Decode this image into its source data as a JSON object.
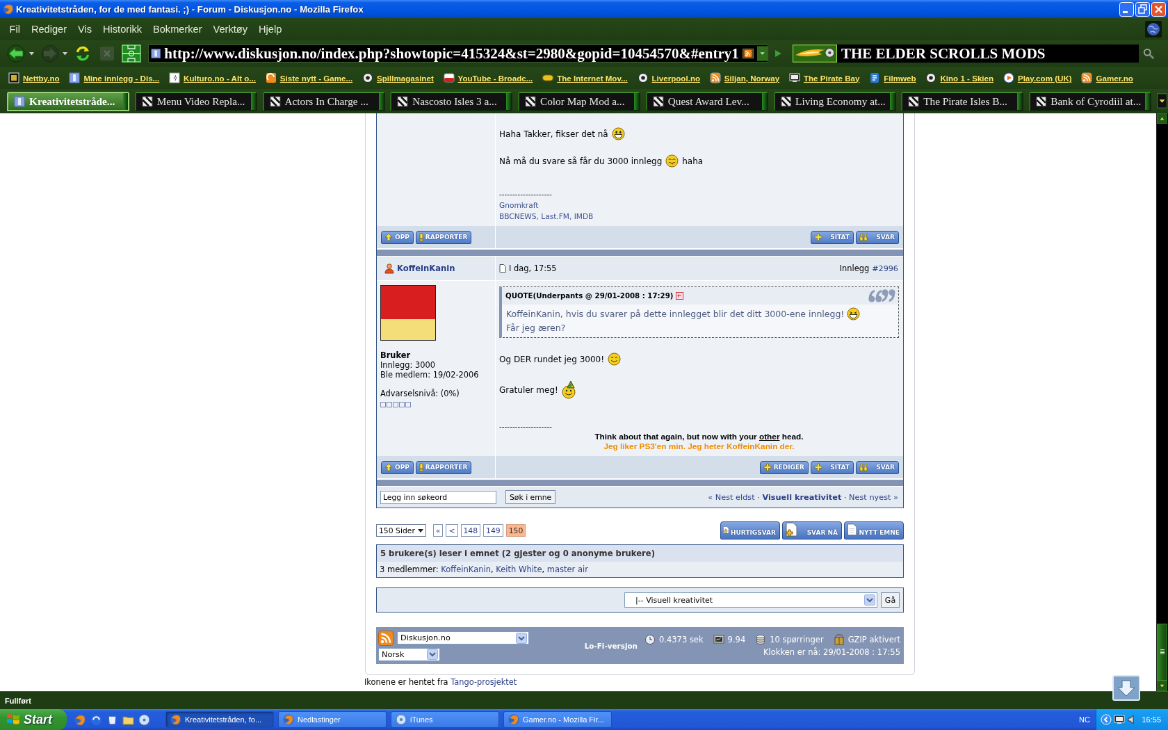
{
  "window": {
    "title": "Kreativitetstråden, for de med fantasi. ;) - Forum - Diskusjon.no - Mozilla Firefox"
  },
  "menu": [
    "Fil",
    "Rediger",
    "Vis",
    "Historikk",
    "Bokmerker",
    "Verktøy",
    "Hjelp"
  ],
  "toolbar": [
    {
      "kind": "back",
      "disabled": false
    },
    {
      "kind": "forward",
      "disabled": true
    },
    {
      "kind": "reload",
      "disabled": false
    },
    {
      "kind": "stop",
      "disabled": true
    },
    {
      "kind": "home",
      "disabled": false
    }
  ],
  "address_bar": {
    "value": "http://www.diskusjon.no/index.php?showtopic=415324&st=2980&gopid=10454570&#entry1"
  },
  "search_bar": {
    "value": "THE ELDER SCROLLS MODS"
  },
  "bookmarks": [
    {
      "label": "Nettby.no",
      "kind": "frame"
    },
    {
      "label": "Mine innlegg - Dis...",
      "kind": "site"
    },
    {
      "label": "Kulturo.no - Alt o...",
      "kind": "sound"
    },
    {
      "label": "Siste nytt - Game...",
      "kind": "swirl"
    },
    {
      "label": "Spillmagasinet",
      "kind": "ball"
    },
    {
      "label": "YouTube - Broadc...",
      "kind": "video"
    },
    {
      "label": "The Internet Mov...",
      "kind": "pill"
    },
    {
      "label": "Liverpool.no",
      "kind": "ball"
    },
    {
      "label": "Siljan, Norway",
      "kind": "feed"
    },
    {
      "label": "The Pirate Bay",
      "kind": "monitor"
    },
    {
      "label": "Filmweb",
      "kind": "document"
    },
    {
      "label": "Kino 1 - Skien",
      "kind": "ball"
    },
    {
      "label": "Play.com (UK)",
      "kind": "play"
    },
    {
      "label": "Gamer.no",
      "kind": "feed"
    }
  ],
  "tabs": [
    {
      "label": "Kreativitetstråde...",
      "selected": true,
      "kind": "site"
    },
    {
      "label": "Menu Video Repla...",
      "selected": false,
      "kind": "tile"
    },
    {
      "label": "Actors In Charge ...",
      "selected": false,
      "kind": "tile"
    },
    {
      "label": "Nascosto Isles 3 a...",
      "selected": false,
      "kind": "tile"
    },
    {
      "label": "Color Map Mod a...",
      "selected": false,
      "kind": "tile"
    },
    {
      "label": "Quest Award Lev...",
      "selected": false,
      "kind": "tile"
    },
    {
      "label": "Living Economy at...",
      "selected": false,
      "kind": "tile"
    },
    {
      "label": "The Pirate Isles B...",
      "selected": false,
      "kind": "tile"
    },
    {
      "label": "Bank of Cyrodiil at...",
      "selected": false,
      "kind": "tile"
    }
  ],
  "forum": {
    "posts": [
      {
        "body": [
          {
            "text": "Haha Takker, fikser det nå",
            "emoticon": {
              "kind": "grin"
            }
          },
          {
            "text": "Nå må du svare så får du 3000 innlegg",
            "emoticon": {
              "kind": "tongue"
            },
            "after": "haha"
          }
        ],
        "signature": {
          "rule": "--------------------",
          "lines": [
            {
              "kind": "link",
              "parts": [
                {
                  "text": "Gnomkraft",
                  "underline": false
                }
              ]
            },
            {
              "kind": "link",
              "parts": [
                {
                  "text": "BBCNEWS, Last.FM, IMDB",
                  "underline": false
                }
              ]
            }
          ]
        },
        "actions_left": [
          {
            "label": "OPP",
            "kind": "up"
          },
          {
            "label": "RAPPORTER",
            "kind": "report"
          }
        ],
        "actions_right": [
          {
            "label": "SITAT",
            "kind": "plus"
          },
          {
            "label": "SVAR",
            "kind": "quote"
          }
        ]
      },
      {
        "author": "KoffeinKanin",
        "date": "I dag, 17:55",
        "number_label": "Innlegg",
        "number": "#2996",
        "profile": {
          "group": "Bruker",
          "lines": [
            "Innlegg: 3000",
            "Ble medlem: 19/02-2006"
          ],
          "warning": {
            "label": "Advarselsnivå: (0%)",
            "stars": 0
          }
        },
        "quote": {
          "header": "QUOTE(Underpants @ 29/01-2008 : 17:29)",
          "lines": [
            {
              "text": "KoffeinKanin, hvis du svarer på dette innlegget blir det ditt 3000-ene innlegg!",
              "emoticon": {
                "kind": "laugh"
              }
            },
            {
              "text": "Får jeg æren?"
            }
          ]
        },
        "body": [
          {
            "text": "Og DER rundet jeg 3000!",
            "emoticon": {
              "kind": "smile"
            }
          },
          {
            "text": "Gratuler meg!",
            "emoticon": {
              "kind": "party"
            }
          }
        ],
        "signature": {
          "rule": "--------------------",
          "lines": [
            {
              "kind": "bold",
              "parts": [
                {
                  "text": "Think about that again, but now with your ",
                  "underline": false
                },
                {
                  "text": "other",
                  "underline": true
                },
                {
                  "text": " head.",
                  "underline": false
                }
              ]
            },
            {
              "kind": "accent",
              "parts": [
                {
                  "text": "Jeg liker PS3'en min. Jeg heter KoffeinKanin der.",
                  "underline": false
                }
              ]
            }
          ]
        },
        "actions_left": [
          {
            "label": "OPP",
            "kind": "up"
          },
          {
            "label": "RAPPORTER",
            "kind": "report"
          }
        ],
        "actions_right": [
          {
            "label": "REDIGER",
            "kind": "plus"
          },
          {
            "label": "SITAT",
            "kind": "plus"
          },
          {
            "label": "SVAR",
            "kind": "quote"
          }
        ]
      }
    ],
    "search": {
      "value": "Legg inn søkeord",
      "button": "Søk i emne",
      "nav": [
        {
          "kind": "link",
          "text": "« Nest eldst"
        },
        {
          "kind": "text",
          "text": " · "
        },
        {
          "kind": "strong",
          "text": "Visuell kreativitet"
        },
        {
          "kind": "text",
          "text": " · "
        },
        {
          "kind": "link",
          "text": "Nest nyest »"
        }
      ]
    },
    "pagination": {
      "label": "150 Sider",
      "links": [
        {
          "label": "«",
          "selected": false
        },
        {
          "label": "<",
          "selected": false
        },
        {
          "label": "148",
          "selected": false
        },
        {
          "label": "149",
          "selected": false
        },
        {
          "label": "150",
          "selected": true
        }
      ]
    },
    "topic_buttons": [
      {
        "label": "HURTIGSVAR",
        "kind": "fast"
      },
      {
        "label": "SVAR NÅ",
        "kind": "reply"
      },
      {
        "label": "NYTT EMNE",
        "kind": "new"
      }
    ],
    "active_users": {
      "title": "5 brukere(s) leser i emnet (2 gjester og 0 anonyme brukere)",
      "members": [
        {
          "kind": "text",
          "text": "3 medlemmer: "
        },
        {
          "kind": "link",
          "text": "KoffeinKanin"
        },
        {
          "kind": "text",
          "text": ", "
        },
        {
          "kind": "link",
          "text": "Keith White"
        },
        {
          "kind": "text",
          "text": ", "
        },
        {
          "kind": "link",
          "text": "master air"
        }
      ]
    },
    "jump": {
      "value": "|-- Visuell kreativitet",
      "button": "Gå"
    },
    "footer": {
      "skin": "Diskusjon.no",
      "language": "Norsk",
      "lofi": "Lo-Fi-versjon",
      "stats": [
        {
          "kind": "time",
          "text": "0.4373 sek"
        },
        {
          "kind": "load",
          "text": "9.94"
        },
        {
          "kind": "queries",
          "text": "10 spørringer"
        },
        {
          "kind": "gzip",
          "text": "GZIP aktivert"
        }
      ],
      "clock": "Klokken er nå: 29/01-2008 : 17:55"
    },
    "credits": [
      {
        "kind": "text",
        "text": "Ikonene er hentet fra "
      },
      {
        "kind": "link",
        "text": "Tango-prosjektet"
      }
    ]
  },
  "status_bar": {
    "text": "Fullført"
  },
  "taskbar": {
    "start": "Start",
    "quick_launch": [
      {
        "kind": "fox"
      },
      {
        "kind": "swirl"
      },
      {
        "kind": "cup"
      },
      {
        "kind": "folder"
      },
      {
        "kind": "disc"
      }
    ],
    "tasks": [
      {
        "label": "Kreativitetstråden, fo...",
        "selected": true,
        "kind": "fox"
      },
      {
        "label": "Nedlastinger",
        "selected": false,
        "kind": "fox"
      },
      {
        "label": "iTunes",
        "selected": false,
        "kind": "disc"
      },
      {
        "label": "Gamer.no - Mozilla Fir...",
        "selected": false,
        "kind": "fox"
      }
    ],
    "tray": {
      "language": "NC",
      "clock": "16:55"
    }
  }
}
